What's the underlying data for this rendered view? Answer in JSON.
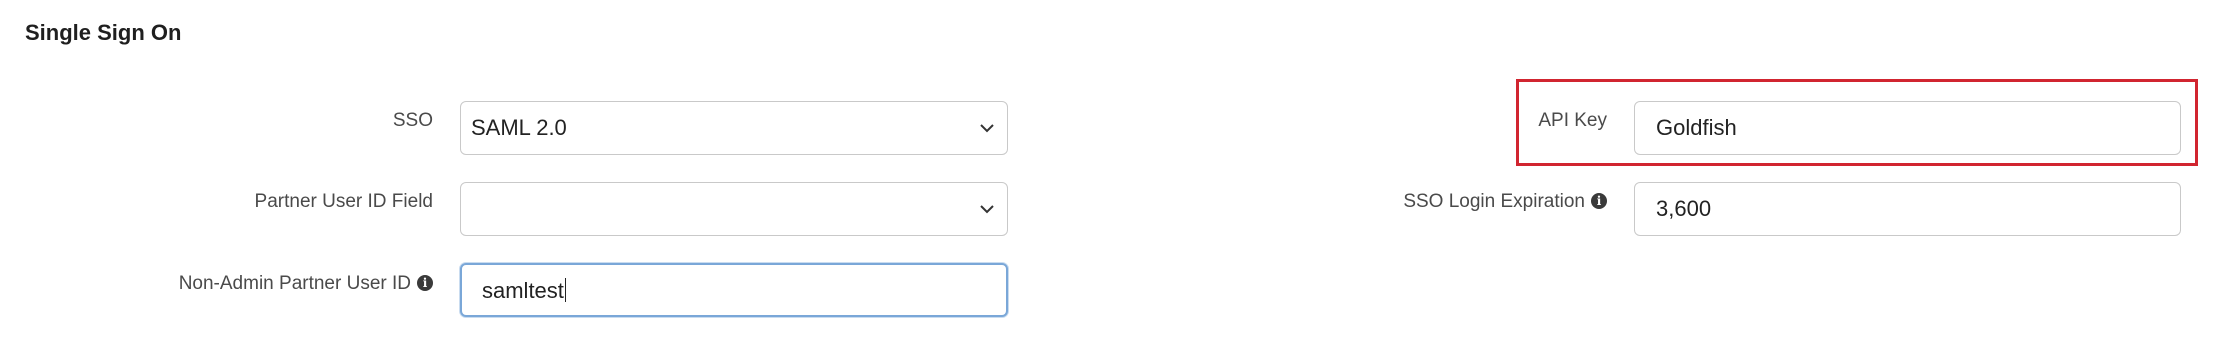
{
  "section": {
    "title": "Single Sign On"
  },
  "left_fields": {
    "sso": {
      "label": "SSO",
      "value": "SAML 2.0"
    },
    "partner_user_id_field": {
      "label": "Partner User ID Field",
      "value": ""
    },
    "non_admin_partner_user_id": {
      "label": "Non-Admin Partner User ID",
      "value": "samltest"
    }
  },
  "right_fields": {
    "api_key": {
      "label": "API Key",
      "value": "Goldfish"
    },
    "sso_login_expiration": {
      "label": "SSO Login Expiration",
      "value": "3,600"
    }
  },
  "icons": {
    "info": "info-circle-icon",
    "dropdown": "chevron-down-icon"
  },
  "colors": {
    "highlight_border": "#d12530",
    "focus_border": "#7aa7d8"
  }
}
